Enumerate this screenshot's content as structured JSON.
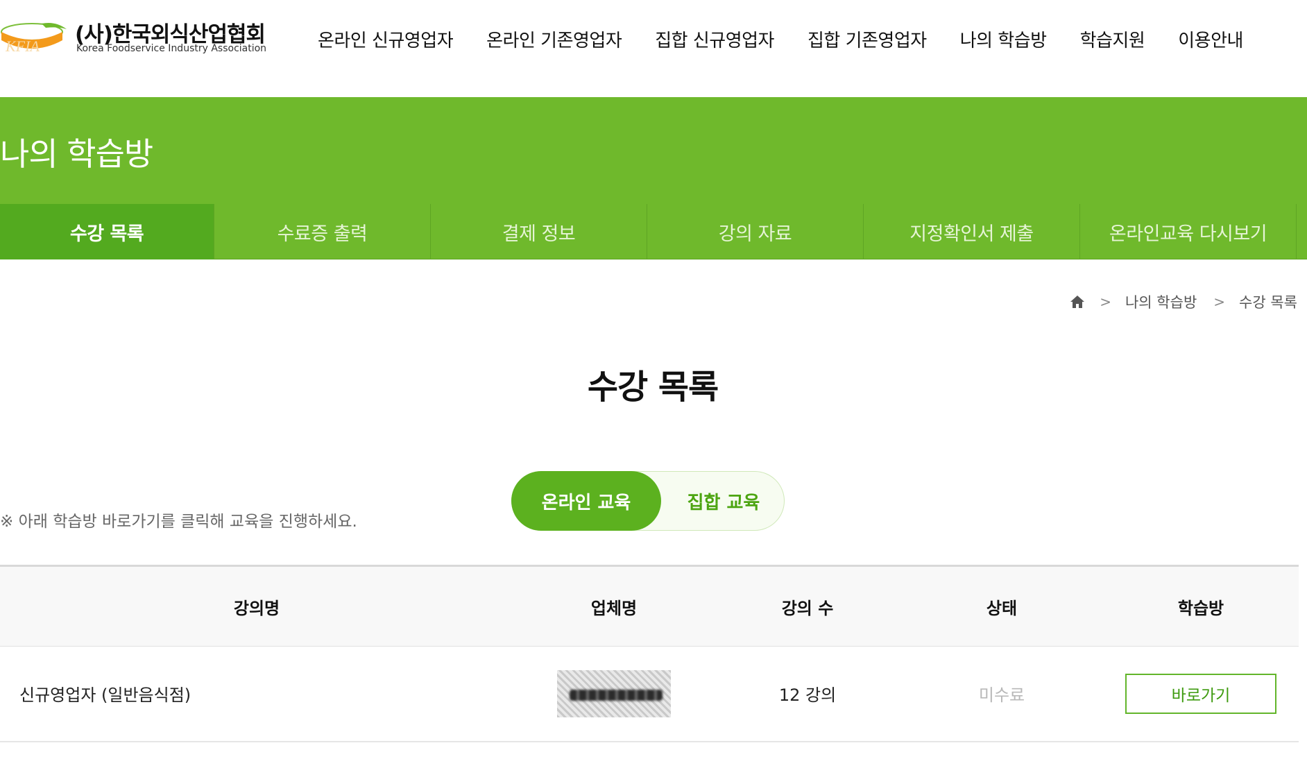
{
  "header": {
    "logo_ko": "(사)한국외식산업협회",
    "logo_en": "Korea Foodservice Industry Association",
    "logo_mark": "KFIA",
    "nav": [
      "온라인 신규영업자",
      "온라인 기존영업자",
      "집합 신규영업자",
      "집합 기존영업자",
      "나의 학습방",
      "학습지원",
      "이용안내"
    ]
  },
  "banner": {
    "title": "나의 학습방"
  },
  "subnav": [
    "수강 목록",
    "수료증 출력",
    "결제 정보",
    "강의 자료",
    "지정확인서 제출",
    "온라인교육 다시보기"
  ],
  "breadcrumb": {
    "home_icon": "home-icon",
    "items": [
      "나의 학습방",
      "수강 목록"
    ],
    "separator": ">"
  },
  "page": {
    "title": "수강 목록",
    "notice": "※ 아래 학습방 바로가기를 클릭해 교육을 진행하세요.",
    "toggle": {
      "online": "온라인 교육",
      "group": "집합 교육",
      "selected": "온라인 교육"
    }
  },
  "table": {
    "headers": [
      "강의명",
      "업체명",
      "강의 수",
      "상태",
      "학습방"
    ],
    "rows": [
      {
        "course": "신규영업자 (일반음식점)",
        "company": "",
        "count": "12 강의",
        "status": "미수료",
        "room": "바로가기"
      }
    ]
  },
  "colors": {
    "brand_green": "#6fb92c",
    "active_tab": "#53aa1f",
    "toggle_on": "#5cb11f",
    "status_gray": "#b8b8b8"
  }
}
